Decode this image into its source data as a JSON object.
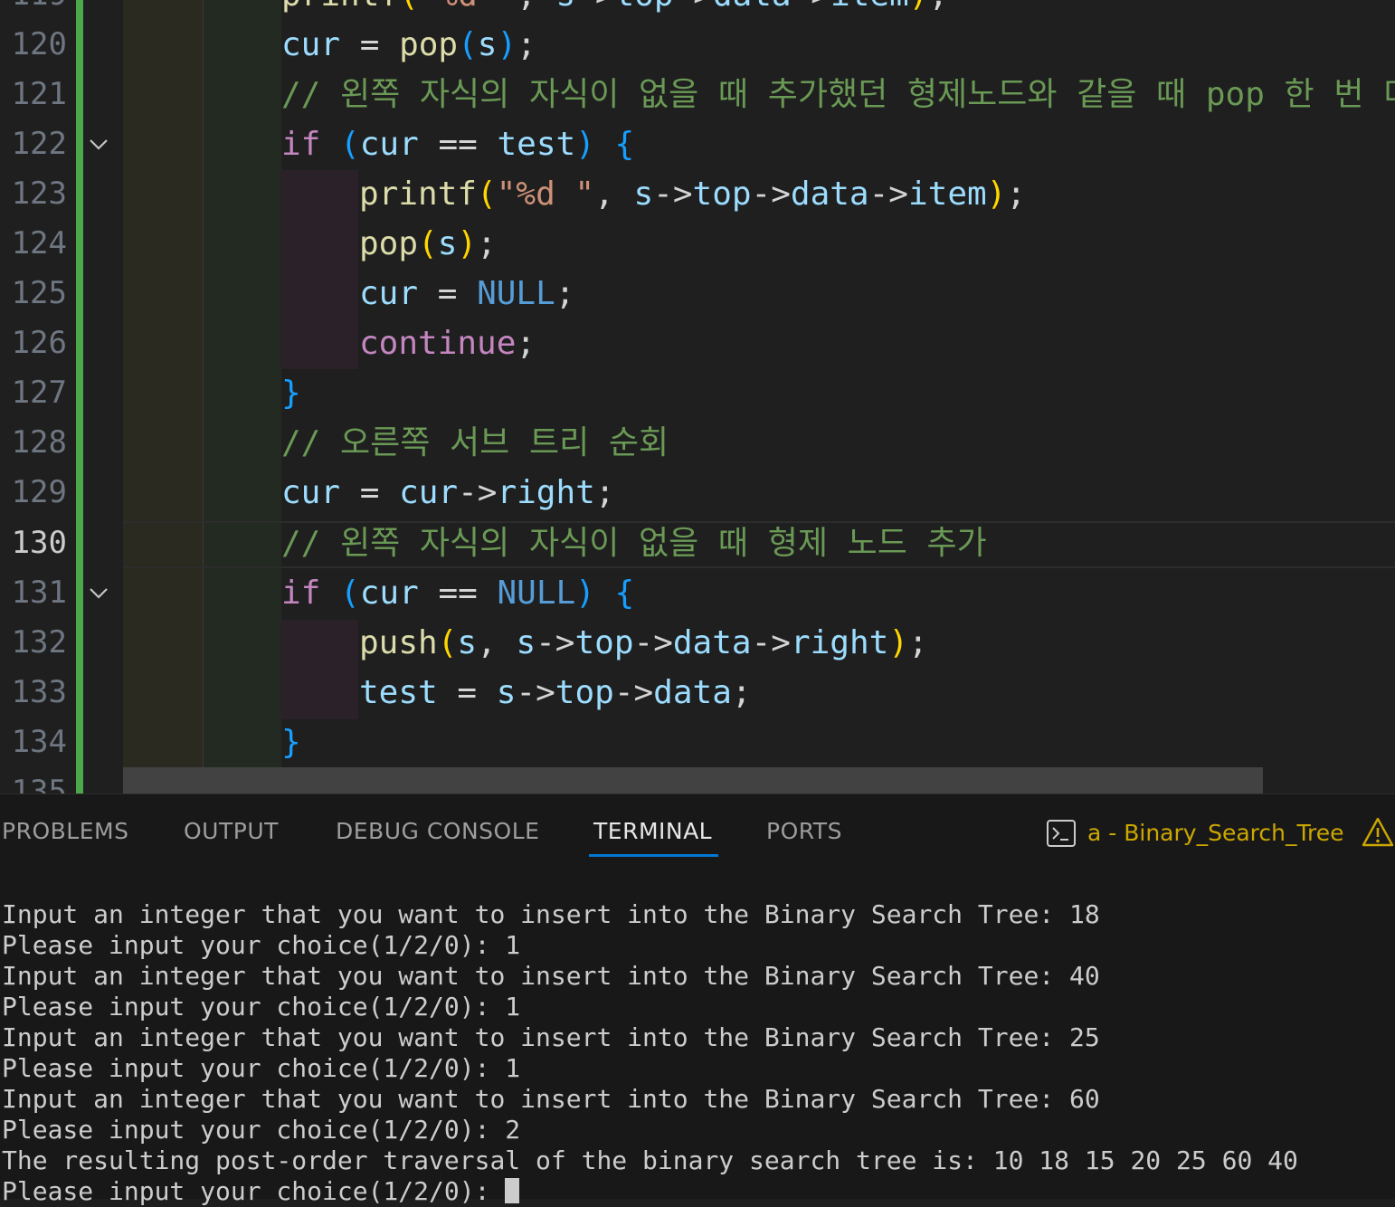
{
  "editor": {
    "partial_top_line": "printf(\"%d \", s->top->data->item);",
    "partial_top_number": "119",
    "partial_bottom_number": "135",
    "active_line": "130",
    "lines": [
      {
        "n": "120"
      },
      {
        "n": "121"
      },
      {
        "n": "122"
      },
      {
        "n": "123"
      },
      {
        "n": "124"
      },
      {
        "n": "125"
      },
      {
        "n": "126"
      },
      {
        "n": "127"
      },
      {
        "n": "128"
      },
      {
        "n": "129"
      },
      {
        "n": "130"
      },
      {
        "n": "131"
      },
      {
        "n": "132"
      },
      {
        "n": "133"
      },
      {
        "n": "134"
      }
    ],
    "tokens": {
      "cur": "cur",
      "eq": " = ",
      "pop": "pop",
      "s": "s",
      "semi": ";",
      "lp": "(",
      "rp": ")",
      "if": "if",
      "eqeq": " == ",
      "test": "test",
      "lb": "{",
      "rb": "}",
      "printf": "printf",
      "fmt": "\"%d \"",
      "comma": ", ",
      "arrow_top": "top",
      "arrow": "->",
      "data": "data",
      "item": "item",
      "null": "NULL",
      "continue": "continue",
      "right": "right",
      "push": "push",
      "sp": " "
    },
    "comments": {
      "c121": "// 왼쪽 자식의 자식이 없을 때 추가했던 형제노드와 같을 때 pop 한 번 더",
      "c128": "// 오른쪽 서브 트리 순회",
      "c130": "// 왼쪽 자식의 자식이 없을 때 형제 노드 추가"
    }
  },
  "panel": {
    "tabs": [
      "PROBLEMS",
      "OUTPUT",
      "DEBUG CONSOLE",
      "TERMINAL",
      "PORTS"
    ],
    "active_tab": "TERMINAL",
    "terminal_name": "a - Binary_Search_Tree",
    "terminal_lines": [
      "Input an integer that you want to insert into the Binary Search Tree: 18",
      "Please input your choice(1/2/0): 1",
      "Input an integer that you want to insert into the Binary Search Tree: 40",
      "Please input your choice(1/2/0): 1",
      "Input an integer that you want to insert into the Binary Search Tree: 25",
      "Please input your choice(1/2/0): 1",
      "Input an integer that you want to insert into the Binary Search Tree: 60",
      "Please input your choice(1/2/0): 2",
      "The resulting post-order traversal of the binary search tree is: 10 18 15 20 25 60 40"
    ],
    "prompt_line": "Please input your choice(1/2/0): "
  },
  "colors": {
    "keyword": "#c586c0",
    "function": "#dcdcaa",
    "variable": "#9cdcfe",
    "constant": "#569cd6",
    "comment": "#6a9955",
    "git_added_bar": "#4ca749",
    "warning": "#cca700",
    "tab_accent": "#0078d4"
  }
}
